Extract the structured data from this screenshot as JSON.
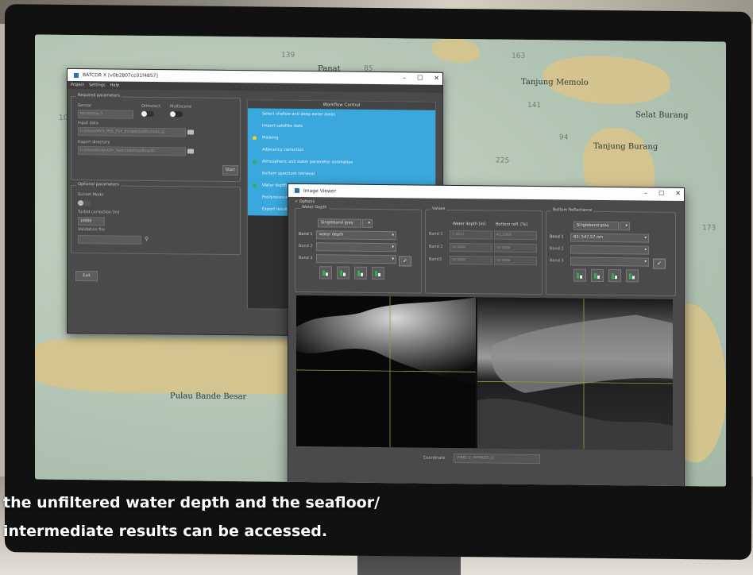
{
  "map": {
    "labels": [
      "Tanjung Memolo",
      "Selat Burang",
      "Tanjung Burang",
      "Pulau Bande Besar",
      "Panat"
    ],
    "numbers": [
      "139",
      "85",
      "163",
      "141",
      "94",
      "225",
      "109",
      "173"
    ]
  },
  "app_window": {
    "title": "BATCOR X   [v0b2807cc01f4857]",
    "menu": [
      "Project",
      "Settings",
      "Help"
    ],
    "required_group": "Required parameters",
    "sensor_label": "Sensor",
    "sensor_value": "WorldView-3",
    "orthorect_label": "Orthorect.",
    "multiscene_label": "Multiscene",
    "input_data_label": "Input data",
    "input_data_value": "C:\\Users\\WV3_MUL_P1K_Europe\\Sub01\\Subs_sc",
    "export_dir_label": "Export directory",
    "export_dir_value": "C:\\Users\\OutputDir_Selected\\Area\\Results",
    "start_button": "Start",
    "optional_group": "Optional parameters",
    "glint_label": "Sunset Mode",
    "turbid_label": "Turbid correction [m]",
    "turbid_value": "10000",
    "validation_label": "Validation file",
    "exit_button": "Exit",
    "workflow": {
      "title": "Workflow Control",
      "items": [
        {
          "label": "Select shallow and deep water areas",
          "dot": ""
        },
        {
          "label": "Import satellite data",
          "dot": ""
        },
        {
          "label": "Masking",
          "dot": "#f2d21a"
        },
        {
          "label": "Adjacency correction",
          "dot": ""
        },
        {
          "label": "Atmospheric and water parameter estimation",
          "dot": "#2fae5d"
        },
        {
          "label": "Bottom spectrum retrieval",
          "dot": ""
        },
        {
          "label": "Water depth ...",
          "dot": "#2fae5d"
        },
        {
          "label": "Postprocessing",
          "dot": ""
        },
        {
          "label": "Export results",
          "dot": ""
        }
      ]
    }
  },
  "image_viewer": {
    "title": "Image Viewer",
    "options_label": "Options",
    "water_depth": {
      "title": "Water Depth",
      "mode": "Singleband gray",
      "band1_label": "Band 1",
      "band1_value": "water depth",
      "band2_label": "Band 2",
      "band3_label": "Band 3"
    },
    "values": {
      "title": "Values",
      "col1": "Water depth [m]",
      "col2": "Bottom refl. [%]",
      "rows": [
        {
          "label": "Band 1",
          "v1": "7.3212",
          "v2": "42.1060"
        },
        {
          "label": "Band 2",
          "v1": "no data",
          "v2": "no data"
        },
        {
          "label": "Band3",
          "v1": "no data",
          "v2": "no data"
        }
      ]
    },
    "bottom_reflectance": {
      "title": "Bottom Reflectance",
      "mode": "Singleband gray",
      "band1_label": "Band 1",
      "band1_value": "B3: 547.57 nm",
      "band2_label": "Band 2",
      "band3_label": "Band 3"
    },
    "coordinate_label": "Coordinate",
    "coordinate_value": "[4881.1, 4769025.1]",
    "win_min": "–",
    "win_max": "☐",
    "win_close": "✕"
  },
  "caption": {
    "line1": "the unfiltered water depth and the seafloor/",
    "line2": "intermediate results can be accessed."
  },
  "colors": {
    "workflow_blue": "#3aa8dc",
    "accent_green": "#2fae5d",
    "accent_yellow": "#f2d21a"
  }
}
